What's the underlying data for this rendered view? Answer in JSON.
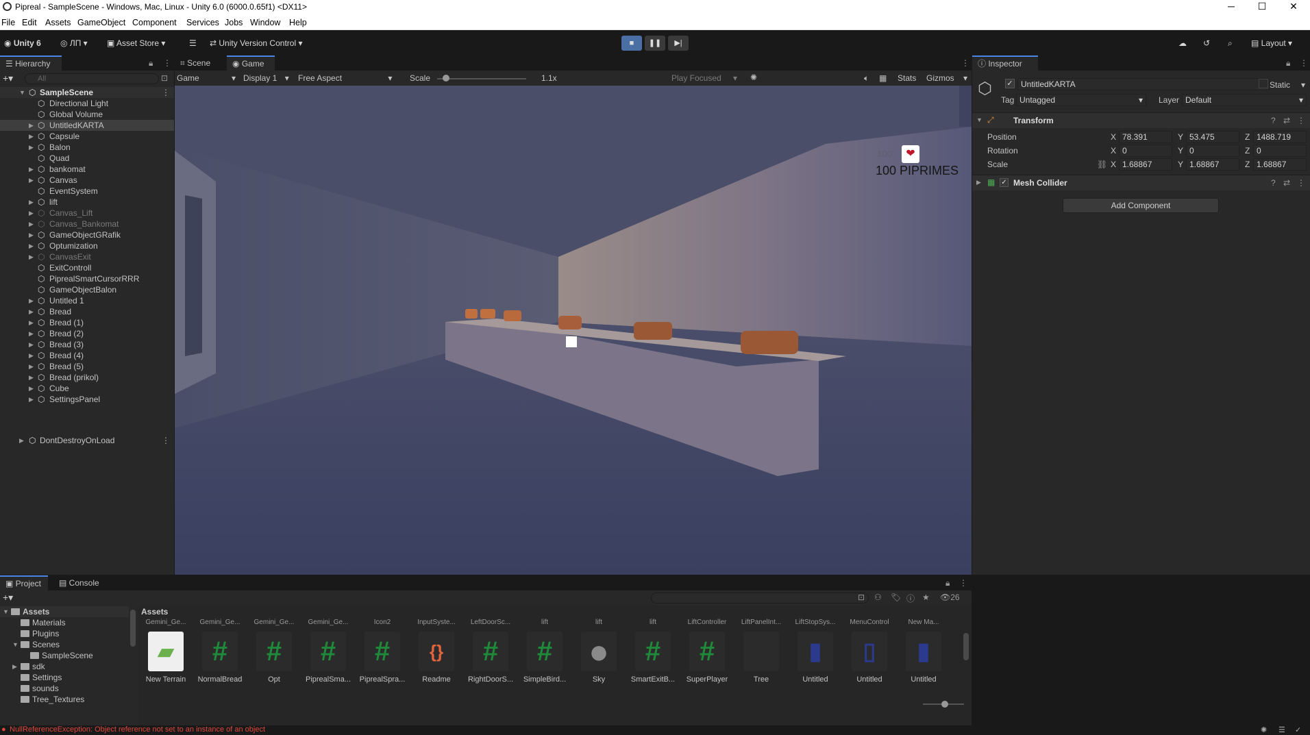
{
  "window": {
    "title": "Pipreal - SampleScene - Windows, Mac, Linux - Unity 6.0 (6000.0.65f1) <DX11>",
    "minimize": "─",
    "maximize": "☐",
    "close": "✕"
  },
  "menu": [
    "File",
    "Edit",
    "Assets",
    "GameObject",
    "Component",
    "Services",
    "Jobs",
    "Window",
    "Help"
  ],
  "toolbar": {
    "unity": "Unity 6",
    "account": "ЛП",
    "asset_store": "Asset Store",
    "version_control": "Unity Version Control",
    "layout": "Layout",
    "play": "▶",
    "pause": "❚❚",
    "step": "▶|"
  },
  "hierarchy": {
    "tab": "Hierarchy",
    "search_placeholder": "All",
    "scene": "SampleScene",
    "items": [
      {
        "name": "Directional Light",
        "arrow": false,
        "dim": false
      },
      {
        "name": "Global Volume",
        "arrow": false,
        "dim": false
      },
      {
        "name": "UntitledKARTA",
        "arrow": true,
        "dim": false
      },
      {
        "name": "Capsule",
        "arrow": true,
        "dim": false
      },
      {
        "name": "Balon",
        "arrow": true,
        "dim": false
      },
      {
        "name": "Quad",
        "arrow": false,
        "dim": false
      },
      {
        "name": "bankomat",
        "arrow": true,
        "dim": false
      },
      {
        "name": "Canvas",
        "arrow": true,
        "dim": false
      },
      {
        "name": "EventSystem",
        "arrow": false,
        "dim": false
      },
      {
        "name": "lift",
        "arrow": true,
        "dim": false
      },
      {
        "name": "Canvas_Lift",
        "arrow": true,
        "dim": true
      },
      {
        "name": "Canvas_Bankomat",
        "arrow": true,
        "dim": true
      },
      {
        "name": "GameObjectGRafik",
        "arrow": true,
        "dim": false
      },
      {
        "name": "Optumization",
        "arrow": true,
        "dim": false
      },
      {
        "name": "CanvasExit",
        "arrow": true,
        "dim": true
      },
      {
        "name": "ExitControll",
        "arrow": false,
        "dim": false
      },
      {
        "name": "PiprealSmartCursorRRR",
        "arrow": false,
        "dim": false
      },
      {
        "name": "GameObjectBalon",
        "arrow": false,
        "dim": false
      },
      {
        "name": "Untitled 1",
        "arrow": true,
        "dim": false
      },
      {
        "name": "Bread",
        "arrow": true,
        "dim": false
      },
      {
        "name": "Bread (1)",
        "arrow": true,
        "dim": false
      },
      {
        "name": "Bread (2)",
        "arrow": true,
        "dim": false
      },
      {
        "name": "Bread (3)",
        "arrow": true,
        "dim": false
      },
      {
        "name": "Bread (4)",
        "arrow": true,
        "dim": false
      },
      {
        "name": "Bread (5)",
        "arrow": true,
        "dim": false
      },
      {
        "name": "Bread (prikol)",
        "arrow": true,
        "dim": false
      },
      {
        "name": "Cube",
        "arrow": true,
        "dim": false
      },
      {
        "name": "SettingsPanel",
        "arrow": true,
        "dim": false
      }
    ],
    "dontdestroy": "DontDestroyOnLoad"
  },
  "view": {
    "tab_scene": "Scene",
    "tab_game": "Game",
    "game_dropdown": "Game",
    "display": "Display 1",
    "aspect": "Free Aspect",
    "scale_label": "Scale",
    "scale_value": "1.1x",
    "play_focused": "Play Focused",
    "stats": "Stats",
    "gizmos": "Gizmos",
    "hud_small": "100",
    "hud_text": "100 PIPRIMES"
  },
  "inspector": {
    "tab": "Inspector",
    "object_name": "UntitledKARTA",
    "static": "Static",
    "tag_label": "Tag",
    "tag_value": "Untagged",
    "layer_label": "Layer",
    "layer_value": "Default",
    "transform": {
      "title": "Transform",
      "position": {
        "label": "Position",
        "x": "78.391",
        "y": "53.475",
        "z": "1488.719"
      },
      "rotation": {
        "label": "Rotation",
        "x": "0",
        "y": "0",
        "z": "0"
      },
      "scale": {
        "label": "Scale",
        "x": "1.68867",
        "y": "1.68867",
        "z": "1.68867"
      }
    },
    "mesh_collider": "Mesh Collider",
    "add_component": "Add Component",
    "axis_x": "X",
    "axis_y": "Y",
    "axis_z": "Z"
  },
  "project": {
    "tab_project": "Project",
    "tab_console": "Console",
    "assets_header": "Assets",
    "count": "26",
    "tree": [
      {
        "name": "Assets",
        "indent": 0,
        "arrow": "▼"
      },
      {
        "name": "Materials",
        "indent": 1,
        "arrow": ""
      },
      {
        "name": "Plugins",
        "indent": 1,
        "arrow": ""
      },
      {
        "name": "Scenes",
        "indent": 1,
        "arrow": "▼"
      },
      {
        "name": "SampleScene",
        "indent": 2,
        "arrow": ""
      },
      {
        "name": "sdk",
        "indent": 1,
        "arrow": "▶"
      },
      {
        "name": "Settings",
        "indent": 1,
        "arrow": ""
      },
      {
        "name": "sounds",
        "indent": 1,
        "arrow": ""
      },
      {
        "name": "Tree_Textures",
        "indent": 1,
        "arrow": ""
      }
    ],
    "top_row": [
      "Gemini_Ge...",
      "Gemini_Ge...",
      "Gemini_Ge...",
      "Gemini_Ge...",
      "Icon2",
      "InputSyste...",
      "LeftDoorSc...",
      "lift",
      "lift",
      "lift",
      "LiftController",
      "LiftPanelInt...",
      "LiftStopSys...",
      "MenuControl",
      "New Ma..."
    ],
    "assets": [
      {
        "name": "New Terrain",
        "glyph": "▰"
      },
      {
        "name": "NormalBread",
        "glyph": "#"
      },
      {
        "name": "Opt",
        "glyph": "#"
      },
      {
        "name": "PiprealSma...",
        "glyph": "#"
      },
      {
        "name": "PiprealSpra...",
        "glyph": "#"
      },
      {
        "name": "Readme",
        "glyph": "{}"
      },
      {
        "name": "RightDoorS...",
        "glyph": "#"
      },
      {
        "name": "SimpleBird...",
        "glyph": "#"
      },
      {
        "name": "Sky",
        "glyph": "●"
      },
      {
        "name": "SmartExitB...",
        "glyph": "#"
      },
      {
        "name": "SuperPlayer",
        "glyph": "#"
      },
      {
        "name": "Tree",
        "glyph": ""
      },
      {
        "name": "Untitled",
        "glyph": "▮"
      },
      {
        "name": "Untitled",
        "glyph": "▯"
      },
      {
        "name": "Untitled",
        "glyph": "▮"
      }
    ]
  },
  "status": {
    "error": "NullReferenceException: Object reference not set to an instance of an object"
  },
  "colors": {
    "accent": "#4a86e8",
    "script_green": "#1f8a3a",
    "error": "#e0473c"
  }
}
